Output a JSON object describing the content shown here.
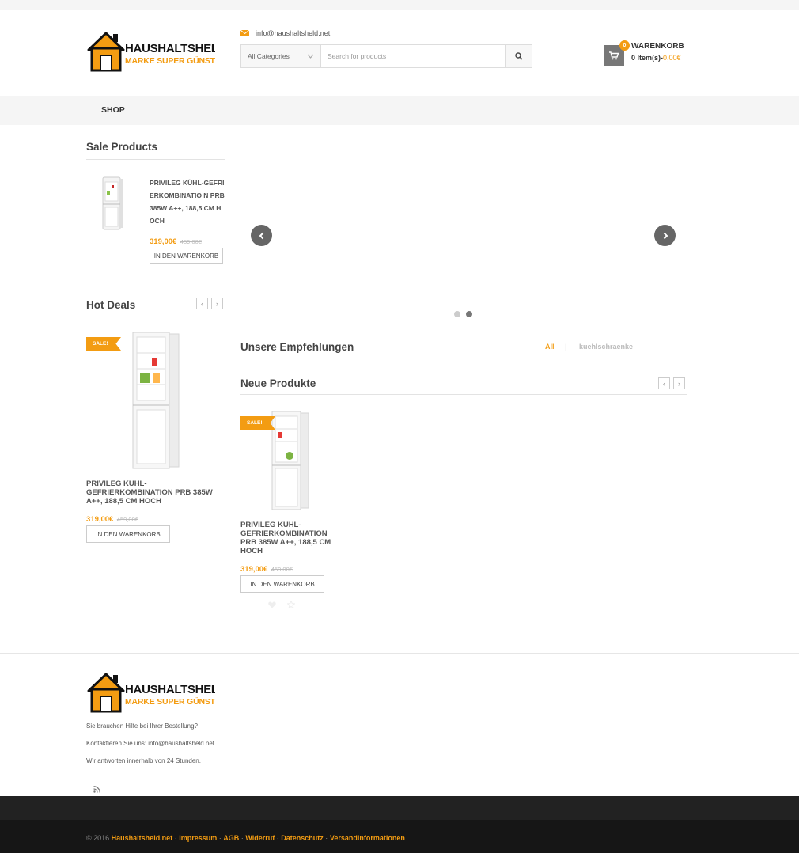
{
  "header": {
    "logo_line1": "HAUSHALTSHELD",
    "logo_line2": "MARKE SUPER GÜNSTIG",
    "email": "info@haushaltsheld.net",
    "search": {
      "category": "All Categories",
      "placeholder": "Search for products"
    },
    "cart": {
      "title": "WARENKORB",
      "count": "0",
      "items": "0 Item(s)",
      "separator": "-",
      "total": "0,00€"
    }
  },
  "nav": {
    "shop": "SHOP"
  },
  "sidebar": {
    "sale_title": "Sale Products",
    "sale_product": {
      "title": "PRIVILEG KÜHL-GEFRIERKOMBINATIO N PRB 385W A++, 188,5 CM HOCH",
      "price": "319,00€",
      "old_price": "459,00€",
      "button": "IN DEN WARENKORB"
    },
    "hot_title": "Hot Deals",
    "hot_product": {
      "tag": "SALE!",
      "title": "PRIVILEG KÜHL-GEFRIERKOMBINATION PRB 385W A++, 188,5 CM HOCH",
      "price": "319,00€",
      "old_price": "459,00€",
      "button": "IN DEN WARENKORB"
    }
  },
  "main": {
    "recommend_title": "Unsere Empfehlungen",
    "filter_all": "All",
    "filter_sep": "|",
    "filter_cat": "kuehlschraenke",
    "new_title": "Neue Produkte",
    "new_product": {
      "tag": "SALE!",
      "title": "PRIVILEG KÜHL-GEFRIERKOMBINATION PRB 385W A++, 188,5 CM HOCH",
      "price": "319,00€",
      "old_price": "459,00€",
      "button": "IN DEN WARENKORB"
    }
  },
  "footer": {
    "logo_line1": "HAUSHALTSHELD",
    "logo_line2": "MARKE SUPER GÜNSTIG",
    "help": "Sie brauchen Hilfe bei Ihrer Bestellung?",
    "contact": "Kontaktieren Sie uns: info@haushaltsheld.net",
    "response": "Wir antworten innerhalb von 24 Stunden.",
    "copyright_prefix": "© 2016",
    "links": [
      "Haushaltsheld.net",
      "Impressum",
      "AGB",
      "Widerruf",
      "Datenschutz",
      "Versandinformationen"
    ],
    "link_sep": "·"
  },
  "colors": {
    "accent": "#f39c12",
    "dark": "#222222"
  }
}
